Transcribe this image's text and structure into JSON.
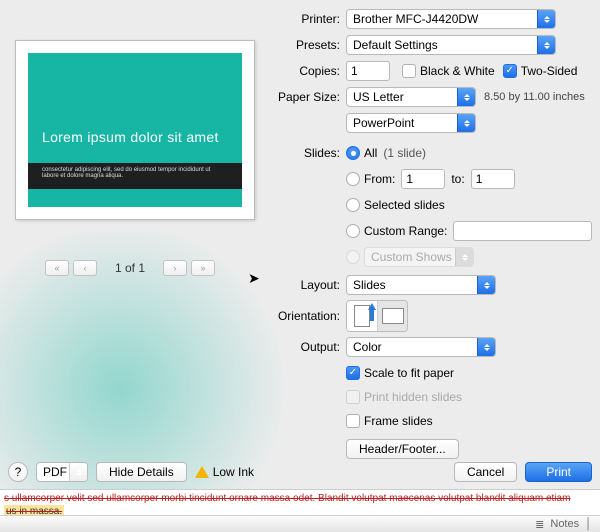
{
  "labels": {
    "printer": "Printer:",
    "presets": "Presets:",
    "copies": "Copies:",
    "paper_size": "Paper Size:",
    "slides": "Slides:",
    "layout": "Layout:",
    "orientation": "Orientation:",
    "output": "Output:"
  },
  "printer": {
    "value": "Brother MFC-J4420DW"
  },
  "presets": {
    "value": "Default Settings"
  },
  "copies": {
    "value": "1",
    "bw_label": "Black & White",
    "twosided_label": "Two-Sided"
  },
  "paper_size": {
    "value": "US Letter",
    "dims": "8.50 by 11.00 inches"
  },
  "app_select": {
    "value": "PowerPoint"
  },
  "slides_opts": {
    "all": "All",
    "all_count": "(1 slide)",
    "from": "From:",
    "from_val": "1",
    "to": "to:",
    "to_val": "1",
    "selected": "Selected slides",
    "custom_range": "Custom Range:",
    "custom_shows": "Custom Shows"
  },
  "layout": {
    "value": "Slides"
  },
  "output": {
    "value": "Color"
  },
  "options": {
    "scale": "Scale to fit paper",
    "hidden": "Print hidden slides",
    "frame": "Frame slides"
  },
  "header_footer_btn": "Header/Footer...",
  "preview": {
    "title": "Lorem ipsum dolor sit amet",
    "sub": "consectetur adipiscing elit, sed do eiusmod tempor incididunt ut labore et dolore magna aliqua."
  },
  "pager": {
    "first": "«",
    "prev": "‹",
    "text": "1 of 1",
    "next": "›",
    "last": "»"
  },
  "footer": {
    "help": "?",
    "pdf": "PDF",
    "hide_details": "Hide Details",
    "low_ink": "Low Ink",
    "cancel": "Cancel",
    "print": "Print"
  },
  "doc": {
    "line1": "s ullamcorper velit sed ullamcorper morbi tincidunt ornare massa odet. Blandit volutpat maecenas volutpat blandit aliquam etiam",
    "line2": "us in massa.",
    "notes": "Notes"
  }
}
